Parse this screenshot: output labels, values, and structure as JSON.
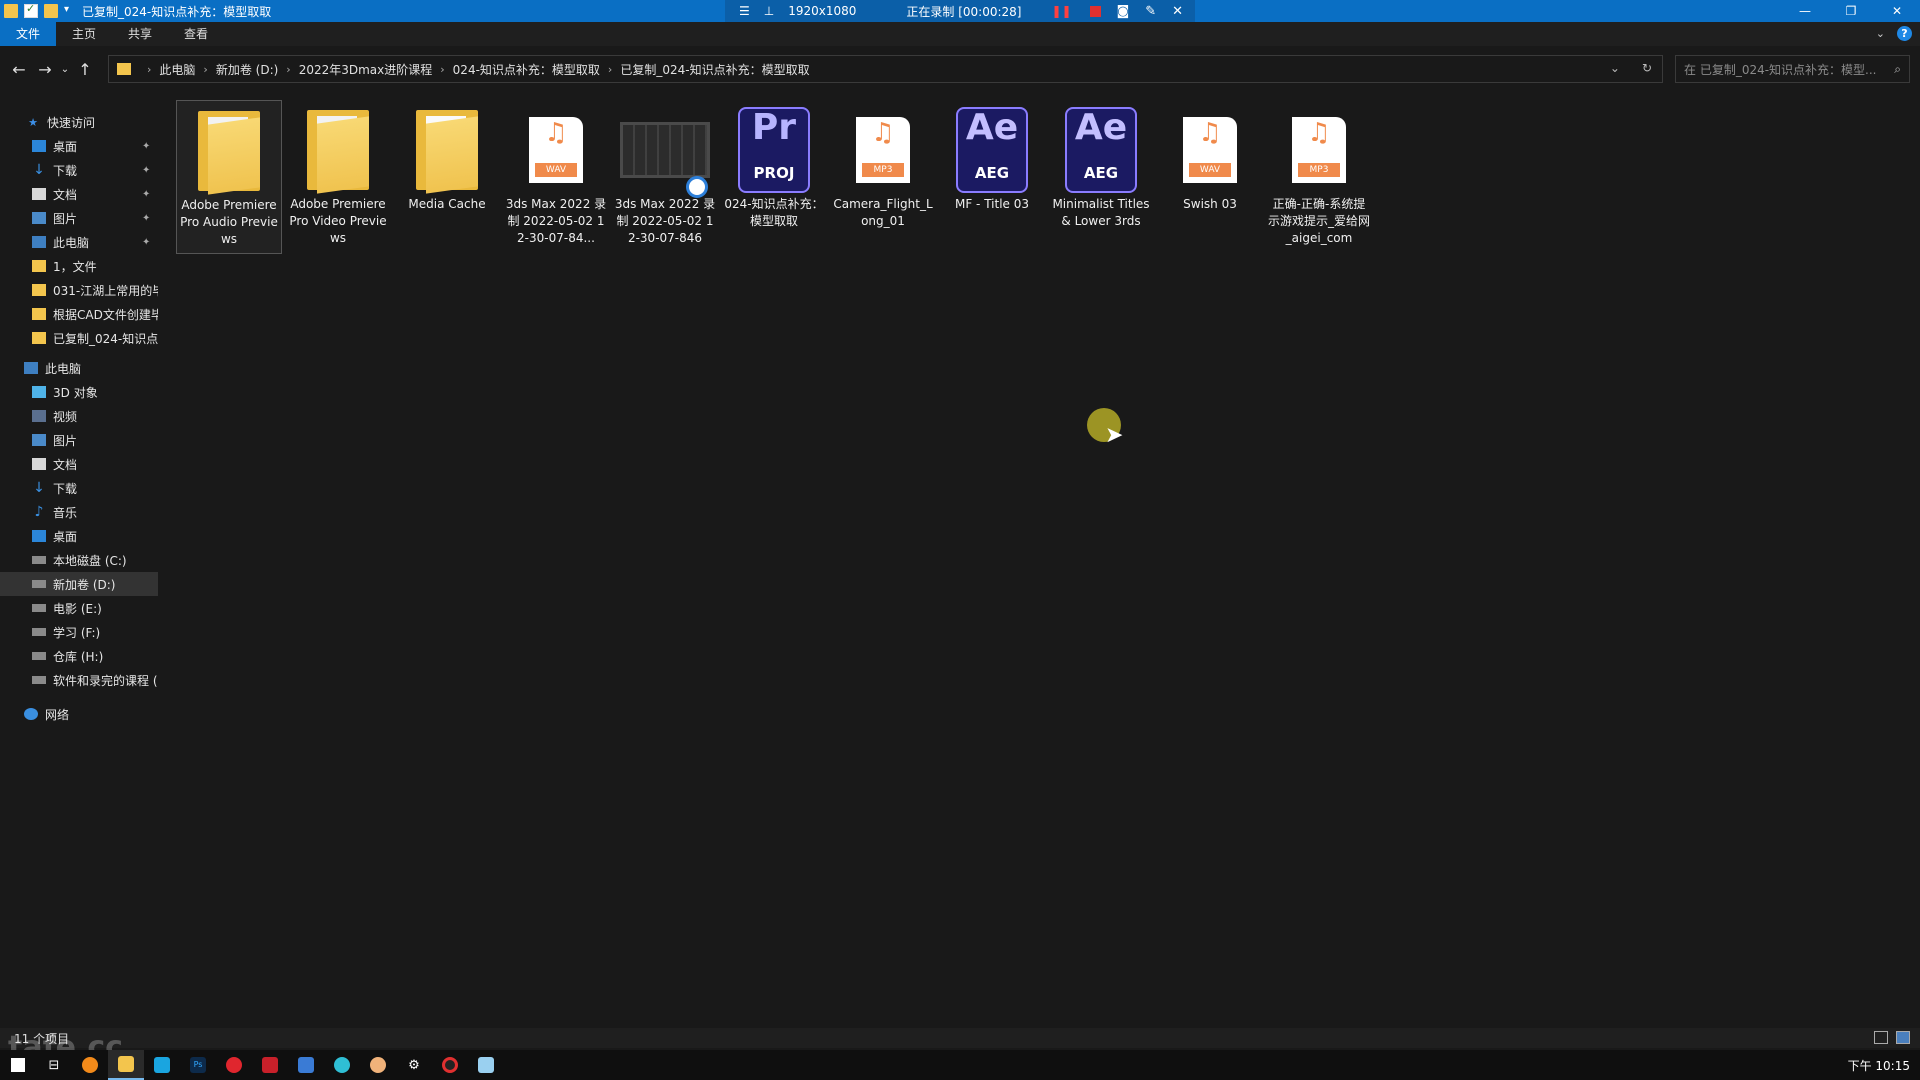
{
  "titlebar": {
    "title": "已复制_024-知识点补充：模型取取",
    "recording": {
      "resolution": "1920x1080",
      "status": "正在录制 [00:00:28]"
    },
    "controls": [
      "minimize-icon",
      "restore-icon",
      "close-icon"
    ]
  },
  "ribbon": {
    "tabs": [
      "文件",
      "主页",
      "共享",
      "查看"
    ],
    "active_tab": "文件"
  },
  "nav": {
    "breadcrumb": [
      "此电脑",
      "新加卷 (D:)",
      "2022年3Dmax进阶课程",
      "024-知识点补充：模型取取",
      "已复制_024-知识点补充：模型取取"
    ],
    "search_placeholder": "在 已复制_024-知识点补充：模型..."
  },
  "sidebar": {
    "quick_access": "快速访问",
    "quick_items": [
      {
        "label": "桌面",
        "icon": "desktop-icon",
        "pinned": true
      },
      {
        "label": "下载",
        "icon": "download-icon",
        "pinned": true
      },
      {
        "label": "文档",
        "icon": "document-icon",
        "pinned": true
      },
      {
        "label": "图片",
        "icon": "picture-icon",
        "pinned": true
      },
      {
        "label": "此电脑",
        "icon": "pc-icon",
        "pinned": true
      },
      {
        "label": "1，文件",
        "icon": "folder-icon",
        "pinned": false
      },
      {
        "label": "031-江湖上常用的毕",
        "icon": "folder-icon",
        "pinned": false
      },
      {
        "label": "根据CAD文件创建毕",
        "icon": "folder-icon",
        "pinned": false
      },
      {
        "label": "已复制_024-知识点",
        "icon": "folder-icon",
        "pinned": false
      }
    ],
    "this_pc": "此电脑",
    "pc_items": [
      {
        "label": "3D 对象",
        "icon": "3d-objects-icon"
      },
      {
        "label": "视频",
        "icon": "video-icon"
      },
      {
        "label": "图片",
        "icon": "picture-icon"
      },
      {
        "label": "文档",
        "icon": "document-icon"
      },
      {
        "label": "下载",
        "icon": "download-icon"
      },
      {
        "label": "音乐",
        "icon": "music-icon"
      },
      {
        "label": "桌面",
        "icon": "desktop-icon"
      },
      {
        "label": "本地磁盘 (C:)",
        "icon": "drive-icon"
      },
      {
        "label": "新加卷 (D:)",
        "icon": "drive-icon",
        "selected": true
      },
      {
        "label": "电影 (E:)",
        "icon": "drive-icon"
      },
      {
        "label": "学习 (F:)",
        "icon": "drive-icon"
      },
      {
        "label": "仓库 (H:)",
        "icon": "drive-icon"
      },
      {
        "label": "软件和录完的课程 (",
        "icon": "drive-icon"
      }
    ],
    "network": "网络"
  },
  "files": [
    {
      "name": "Adobe Premiere Pro Audio Previews",
      "type": "folder"
    },
    {
      "name": "Adobe Premiere Pro Video Previews",
      "type": "folder"
    },
    {
      "name": "Media Cache",
      "type": "folder"
    },
    {
      "name": "3ds Max 2022 录制 2022-05-02 12-30-07-84...",
      "type": "wav",
      "tag": "WAV"
    },
    {
      "name": "3ds Max 2022 录制 2022-05-02 12-30-07-846",
      "type": "video"
    },
    {
      "name": "024-知识点补充：模型取取",
      "type": "prproj",
      "big": "Pr",
      "small": "PROJ"
    },
    {
      "name": "Camera_Flight_Long_01",
      "type": "mp3",
      "tag": "MP3"
    },
    {
      "name": "MF - Title 03",
      "type": "aeg",
      "big": "Ae",
      "small": "AEG"
    },
    {
      "name": "Minimalist Titles & Lower 3rds",
      "type": "aeg",
      "big": "Ae",
      "small": "AEG"
    },
    {
      "name": "Swish 03",
      "type": "wav",
      "tag": "WAV"
    },
    {
      "name": "正确-正确-系统提示游戏提示_爱给网_aigei_com",
      "type": "mp3",
      "tag": "MP3"
    }
  ],
  "status": {
    "count": "11 个项目"
  },
  "watermark": "tafe.cc",
  "taskbar": {
    "clock": "下午 10:15"
  }
}
